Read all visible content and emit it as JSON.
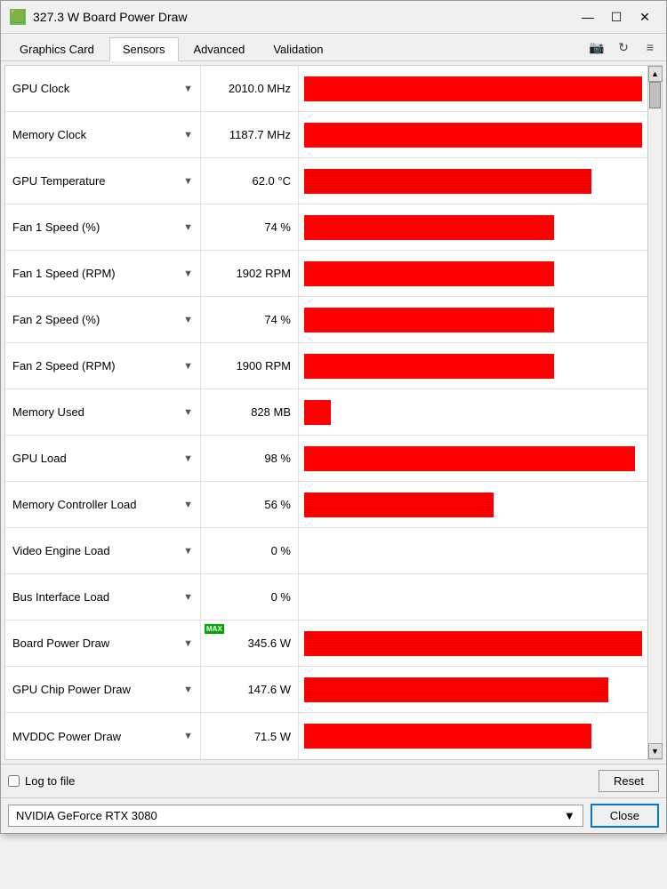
{
  "window": {
    "title": "327.3 W Board Power Draw",
    "icon": "🟩"
  },
  "title_controls": {
    "minimize": "—",
    "maximize": "☐",
    "close": "✕"
  },
  "tabs": [
    {
      "id": "graphics-card",
      "label": "Graphics Card",
      "active": false
    },
    {
      "id": "sensors",
      "label": "Sensors",
      "active": true
    },
    {
      "id": "advanced",
      "label": "Advanced",
      "active": false
    },
    {
      "id": "validation",
      "label": "Validation",
      "active": false
    }
  ],
  "tab_actions": {
    "camera": "📷",
    "refresh": "↻",
    "menu": "≡"
  },
  "sensors": [
    {
      "name": "GPU Clock",
      "value": "2010.0 MHz",
      "bar_pct": 100,
      "noise": false,
      "has_max": false
    },
    {
      "name": "Memory Clock",
      "value": "1187.7 MHz",
      "bar_pct": 100,
      "noise": false,
      "has_max": false
    },
    {
      "name": "GPU Temperature",
      "value": "62.0 °C",
      "bar_pct": 85,
      "noise": true,
      "has_max": false
    },
    {
      "name": "Fan 1 Speed (%)",
      "value": "74 %",
      "bar_pct": 74,
      "noise": false,
      "has_max": false
    },
    {
      "name": "Fan 1 Speed (RPM)",
      "value": "1902 RPM",
      "bar_pct": 74,
      "noise": false,
      "has_max": false
    },
    {
      "name": "Fan 2 Speed (%)",
      "value": "74 %",
      "bar_pct": 74,
      "noise": false,
      "has_max": false
    },
    {
      "name": "Fan 2 Speed (RPM)",
      "value": "1900 RPM",
      "bar_pct": 74,
      "noise": false,
      "has_max": false
    },
    {
      "name": "Memory Used",
      "value": "828 MB",
      "bar_pct": 8,
      "noise": false,
      "has_max": false
    },
    {
      "name": "GPU Load",
      "value": "98 %",
      "bar_pct": 98,
      "noise": false,
      "has_max": false
    },
    {
      "name": "Memory Controller Load",
      "value": "56 %",
      "bar_pct": 56,
      "noise": true,
      "has_max": false
    },
    {
      "name": "Video Engine Load",
      "value": "0 %",
      "bar_pct": 0,
      "noise": false,
      "has_max": false
    },
    {
      "name": "Bus Interface Load",
      "value": "0 %",
      "bar_pct": 0,
      "noise": false,
      "has_max": false
    },
    {
      "name": "Board Power Draw",
      "value": "345.6 W",
      "bar_pct": 100,
      "noise": true,
      "has_max": true
    },
    {
      "name": "GPU Chip Power Draw",
      "value": "147.6 W",
      "bar_pct": 90,
      "noise": true,
      "has_max": false
    },
    {
      "name": "MVDDC Power Draw",
      "value": "71.5 W",
      "bar_pct": 85,
      "noise": false,
      "has_max": false
    }
  ],
  "bottom": {
    "log_label": "Log to file",
    "reset_label": "Reset"
  },
  "footer": {
    "gpu_name": "NVIDIA GeForce RTX 3080",
    "close_label": "Close"
  }
}
